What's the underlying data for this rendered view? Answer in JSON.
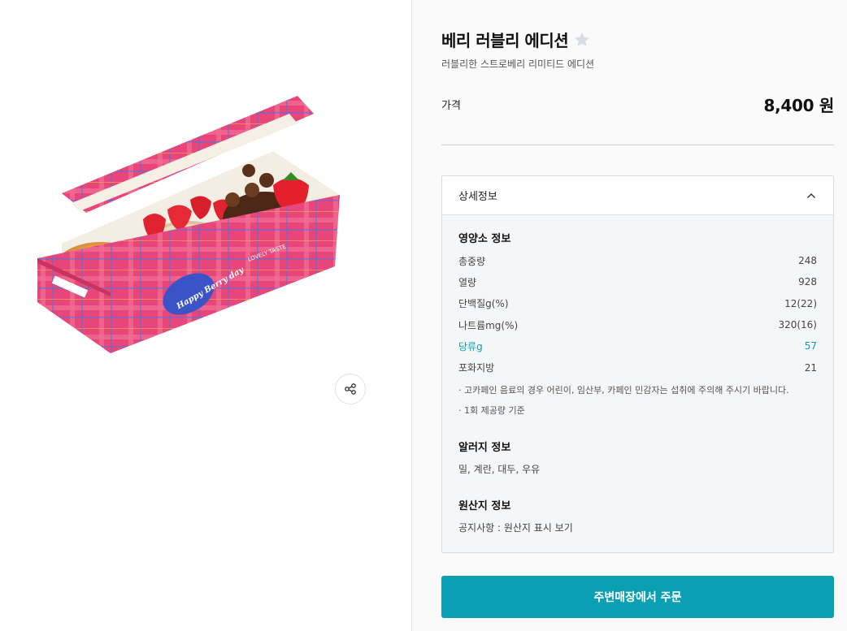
{
  "product": {
    "title": "베리 러블리 에디션",
    "subtitle": "러블리한 스트로베리 리미티드 에디션",
    "price_label": "가격",
    "price_value": "8,400 원",
    "box_print_brand": "LOVELY TASTE",
    "box_print_greeting": "Happy Berry day"
  },
  "detail": {
    "header_label": "상세정보",
    "nutrition_title": "영양소 정보",
    "nutrition": [
      {
        "label": "총중량",
        "value": "248"
      },
      {
        "label": "열량",
        "value": "928"
      },
      {
        "label": "단백질g(%)",
        "value": "12(22)"
      },
      {
        "label": "나트륨mg(%)",
        "value": "320(16)"
      },
      {
        "label": "당류g",
        "value": "57"
      },
      {
        "label": "포화지방",
        "value": "21"
      }
    ],
    "notes": [
      "· 고카페인 음료의 경우 어린이, 임산부, 카페인 민감자는 섭취에 주의해 주시기 바랍니다.",
      "· 1회 제공량 기준"
    ],
    "allergy_title": "알러지 정보",
    "allergy_text": "밀, 계란, 대두, 우유",
    "origin_title": "원산지 정보",
    "origin_text": "공지사항 : 원산지 표시 보기"
  },
  "order": {
    "button_label": "주변매장에서 주문"
  },
  "icons": {
    "favorite": "star-icon",
    "share": "share-icon",
    "collapse": "chevron-up-icon"
  },
  "colors": {
    "accent": "#0a9fb2",
    "box_pink": "#e8457a",
    "highlight_text": "#0a9fb2"
  }
}
